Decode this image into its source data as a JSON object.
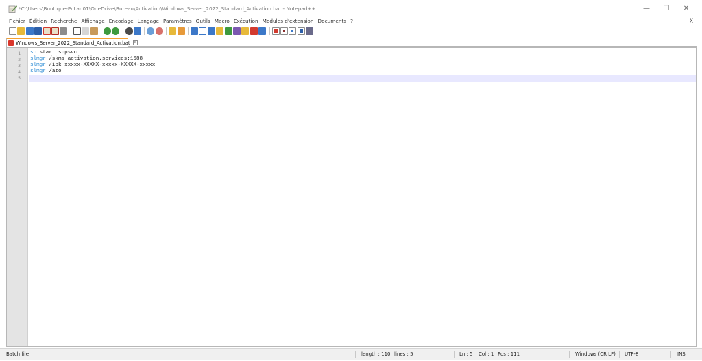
{
  "window": {
    "title": "*C:\\Users\\Boutique-PcLan01\\OneDrive\\Bureau\\Activation\\Windows_Server_2022_Standard_Activation.bat - Notepad++",
    "minimize_glyph": "—",
    "maximize_glyph": "☐",
    "close_glyph": "✕"
  },
  "menu": {
    "items": [
      "Fichier",
      "Édition",
      "Recherche",
      "Affichage",
      "Encodage",
      "Langage",
      "Paramètres",
      "Outils",
      "Macro",
      "Exécution",
      "Modules d'extension",
      "Documents",
      "?"
    ],
    "close_glyph": "X"
  },
  "toolbar": {
    "icons": [
      "new-file-icon",
      "open-file-icon",
      "save-icon",
      "save-all-icon",
      "close-icon",
      "close-all-icon",
      "print-icon",
      "cut-icon",
      "copy-icon",
      "paste-icon",
      "undo-icon",
      "redo-icon",
      "find-icon",
      "replace-icon",
      "zoom-in-icon",
      "zoom-out-icon",
      "sync-vertical-icon",
      "sync-horizontal-icon",
      "word-wrap-icon",
      "show-all-chars-icon",
      "indent-guide-icon",
      "lang-define-icon",
      "doc-map-icon",
      "function-list-icon",
      "folder-workspace-icon",
      "doc-list-icon",
      "monitoring-icon",
      "record-macro-icon",
      "stop-macro-icon",
      "play-macro-icon",
      "play-multiple-icon",
      "save-macro-icon"
    ],
    "colors": {
      "blue": "#3c78c8",
      "green": "#3e9a3e",
      "red": "#d23a2e",
      "yellow": "#e7b93a",
      "gray": "#8c8c8c",
      "purple": "#7b58b0"
    }
  },
  "tab": {
    "label": "Windows_Server_2022_Standard_Activation.bat",
    "close_glyph": "x",
    "accent": "#f5a032"
  },
  "editor": {
    "lines": [
      {
        "number": "1",
        "keyword": "sc",
        "rest": " start sppsvc"
      },
      {
        "number": "2",
        "keyword": "slmgr",
        "rest": " /skms activation.services:1688"
      },
      {
        "number": "3",
        "keyword": "slmgr",
        "rest": " /ipk xxxxx-XXXXX-xxxxx-XXXXX-xxxxx"
      },
      {
        "number": "4",
        "keyword": "slmgr",
        "rest": " /ato"
      },
      {
        "number": "5",
        "keyword": "",
        "rest": ""
      }
    ],
    "current_line": 5,
    "keyword_color": "#2a8bd4"
  },
  "status": {
    "file_type": "Batch file",
    "length": "length : 110",
    "lines": "lines : 5",
    "ln": "Ln : 5",
    "col": "Col : 1",
    "pos": "Pos : 111",
    "eol": "Windows (CR LF)",
    "encoding": "UTF-8",
    "mode": "INS"
  }
}
